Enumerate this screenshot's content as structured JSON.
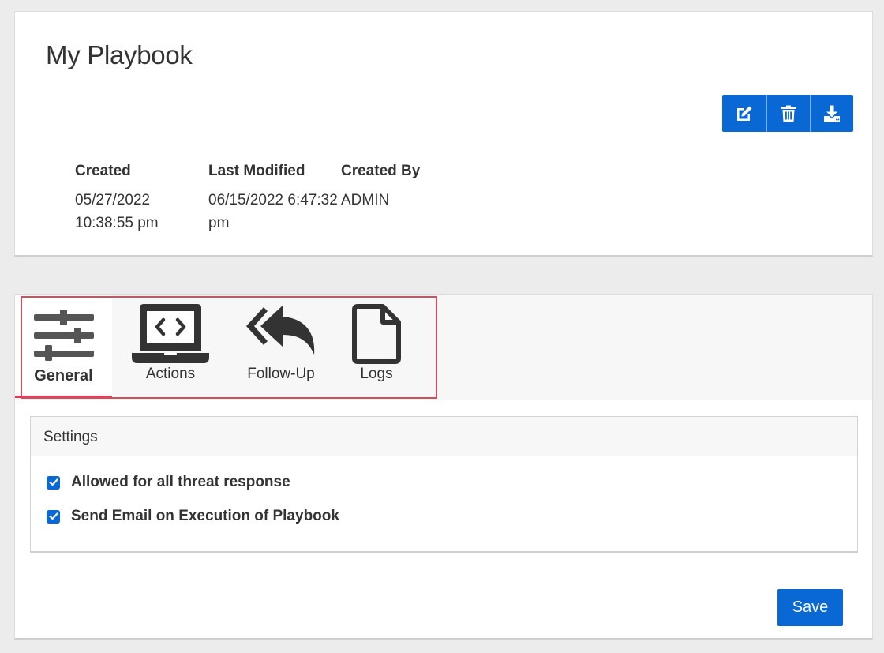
{
  "header": {
    "title": "My Playbook",
    "actions": [
      {
        "icon": "edit-icon"
      },
      {
        "icon": "trash-icon"
      },
      {
        "icon": "download-icon"
      }
    ]
  },
  "meta": {
    "created_label": "Created",
    "created_value_line1": "05/27/2022",
    "created_value_line2": "10:38:55 pm",
    "modified_label": "Last Modified",
    "modified_value_line1": "06/15/2022 6:47:32",
    "modified_value_line2": "pm",
    "created_by_label": "Created By",
    "created_by_value": "ADMIN"
  },
  "tabs": [
    {
      "label": "General",
      "icon": "sliders-icon",
      "active": true
    },
    {
      "label": "Actions",
      "icon": "laptop-code-icon",
      "active": false
    },
    {
      "label": "Follow-Up",
      "icon": "reply-all-icon",
      "active": false
    },
    {
      "label": "Logs",
      "icon": "file-icon",
      "active": false
    }
  ],
  "settings": {
    "heading": "Settings",
    "options": [
      {
        "label": "Allowed for all threat response",
        "checked": true
      },
      {
        "label": "Send Email on Execution of Playbook",
        "checked": true
      }
    ]
  },
  "save_label": "Save",
  "colors": {
    "primary": "#0a68d4",
    "active_tab_underline": "#e03a57",
    "highlight_box": "#d94b5e",
    "background": "#ececec"
  }
}
